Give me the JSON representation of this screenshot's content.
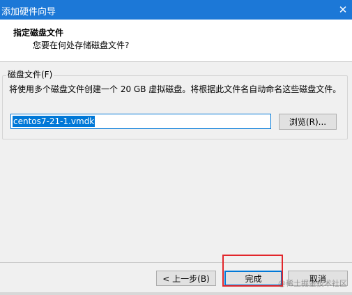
{
  "window": {
    "title": "添加硬件向导",
    "close_symbol": "✕"
  },
  "header": {
    "heading": "指定磁盘文件",
    "subheading": "您要在何处存储磁盘文件?"
  },
  "disk_file_group": {
    "legend": "磁盘文件(F)",
    "description": "将使用多个磁盘文件创建一个 20 GB 虚拟磁盘。将根据此文件名自动命名这些磁盘文件。",
    "filename_value": "centos7-21-1.vmdk",
    "browse_label": "浏览(R)..."
  },
  "footer": {
    "back_label": "< 上一步(B)",
    "finish_label": "完成",
    "cancel_label": "取消"
  },
  "watermark": "@稀土掘金技术社区",
  "colors": {
    "titlebar": "#1c78d7",
    "selection": "#0078d7",
    "highlight": "#e2262b"
  }
}
